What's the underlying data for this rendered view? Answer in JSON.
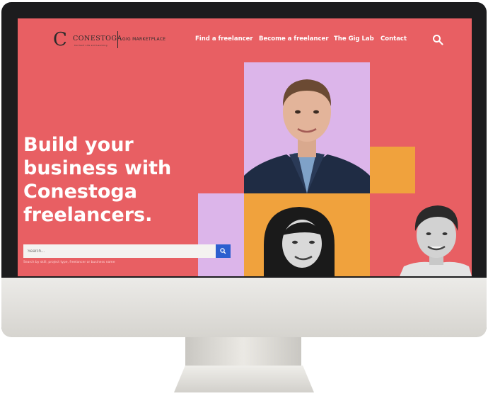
{
  "brand": {
    "mark": "C",
    "name": "CONESTOGA",
    "tagline": "Connect Life and Learning",
    "marketplace": "GIG MARKETPLACE"
  },
  "nav": {
    "items": [
      {
        "label": "Find a freelancer"
      },
      {
        "label": "Become a freelancer"
      },
      {
        "label": "The Gig Lab"
      },
      {
        "label": "Contact"
      }
    ]
  },
  "hero": {
    "headline_lines": [
      "Build your",
      "business with",
      "Conestoga",
      "freelancers."
    ],
    "search_placeholder": "Search...",
    "search_helper": "Search by skill, project type, freelancer or business name"
  },
  "colors": {
    "background": "#e85f63",
    "lilac": "#dcb5ea",
    "orange": "#f0a23d",
    "accent_blue": "#2c5fcf"
  },
  "icons": [
    "search-icon"
  ]
}
